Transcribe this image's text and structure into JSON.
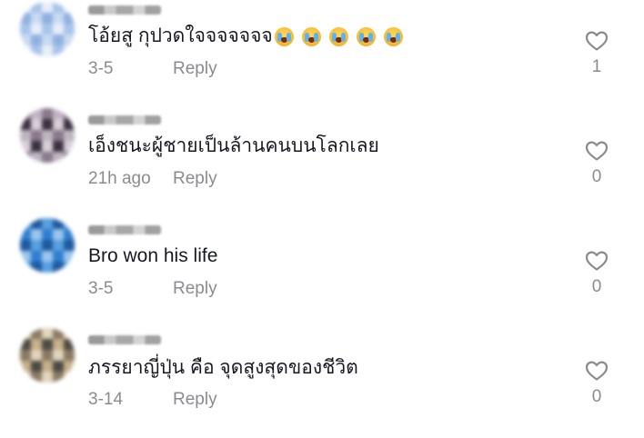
{
  "comments": [
    {
      "username": "P",
      "text": "โอ้ยสู กุปวดใจจจจจจจ",
      "emojis": [
        "loudly-crying-face-emoji",
        "loudly-crying-face-emoji",
        "loudly-crying-face-emoji",
        "loudly-crying-face-emoji",
        "loudly-crying-face-emoji"
      ],
      "date": "3-5",
      "reply_label": "Reply",
      "likes": "1",
      "avatar_colors": [
        "#e8eef8",
        "#c9daf2",
        "#a9c4ea",
        "#8fb0e0"
      ]
    },
    {
      "username": "M",
      "text": "เอ็งชนะผู้ชายเป็นล้านคนบนโลกเลย",
      "date": "21h ago",
      "reply_label": "Reply",
      "likes": "0",
      "avatar_colors": [
        "#3b3140",
        "#8a7a8c",
        "#d9cfd8",
        "#bfb4c2"
      ]
    },
    {
      "username": "B",
      "text": "Bro won his life",
      "date": "3-5",
      "reply_label": "Reply",
      "likes": "0",
      "avatar_colors": [
        "#1f5aa0",
        "#2f7fd0",
        "#5aa0e0",
        "#9cc6ee"
      ]
    },
    {
      "username": "T",
      "text": "ภรรยาญี่ปุ่น คือ จุดสูงสุดของชีวิต",
      "date": "3-14",
      "reply_label": "Reply",
      "likes": "0",
      "avatar_colors": [
        "#c7b08a",
        "#8a7a64",
        "#4d4a44",
        "#e2d5bd"
      ]
    }
  ]
}
